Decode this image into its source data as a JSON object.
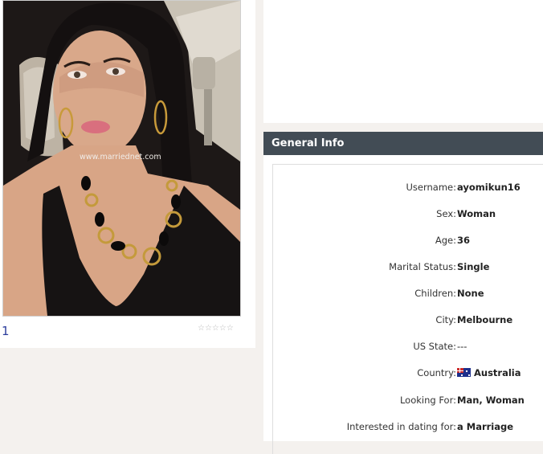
{
  "photo": {
    "watermark": "www.marriednet.com",
    "index": "1",
    "stars": "☆☆☆☆☆"
  },
  "general_info": {
    "title": "General Info",
    "fields": [
      {
        "label": "Username:",
        "value": "ayomikun16"
      },
      {
        "label": "Sex:",
        "value": "Woman"
      },
      {
        "label": "Age:",
        "value": "36"
      },
      {
        "label": "Marital Status:",
        "value": "Single"
      },
      {
        "label": "Children:",
        "value": "None"
      },
      {
        "label": "City:",
        "value": "Melbourne"
      },
      {
        "label": "US State:",
        "value": "---"
      },
      {
        "label": "Country:",
        "value": "Australia",
        "icon": "australia-flag-icon"
      },
      {
        "label": "Looking For:",
        "value": "Man, Woman"
      },
      {
        "label": "Interested in dating for:",
        "value": "a Marriage"
      }
    ]
  }
}
